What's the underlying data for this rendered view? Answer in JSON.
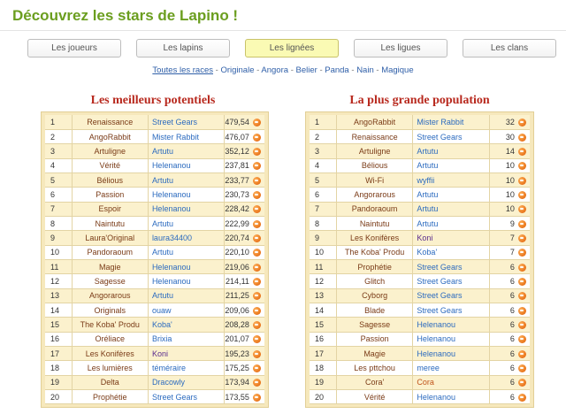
{
  "page": {
    "title": "Découvrez les stars de Lapino !"
  },
  "tabs": [
    {
      "label": "Les joueurs",
      "active": false
    },
    {
      "label": "Les lapins",
      "active": false
    },
    {
      "label": "Les lignées",
      "active": true
    },
    {
      "label": "Les ligues",
      "active": false
    },
    {
      "label": "Les clans",
      "active": false
    }
  ],
  "races": [
    "Toutes les races",
    "Originale",
    "Angora",
    "Belier",
    "Panda",
    "Nain",
    "Magique"
  ],
  "left": {
    "title": "Les meilleurs potentiels",
    "rows": [
      {
        "rank": "1",
        "name": "Renaissance",
        "player": "Street Gears",
        "value": "479,54",
        "player_color": "blue"
      },
      {
        "rank": "2",
        "name": "AngoRabbit",
        "player": "Mister Rabbit",
        "value": "476,07",
        "player_color": "blue"
      },
      {
        "rank": "3",
        "name": "Artuligne",
        "player": "Artutu",
        "value": "352,12",
        "player_color": "blue"
      },
      {
        "rank": "4",
        "name": "Vérité",
        "player": "Helenanou",
        "value": "237,81",
        "player_color": "blue"
      },
      {
        "rank": "5",
        "name": "Bélious",
        "player": "Artutu",
        "value": "233,77",
        "player_color": "blue"
      },
      {
        "rank": "6",
        "name": "Passion",
        "player": "Helenanou",
        "value": "230,73",
        "player_color": "blue"
      },
      {
        "rank": "7",
        "name": "Espoir",
        "player": "Helenanou",
        "value": "228,42",
        "player_color": "blue"
      },
      {
        "rank": "8",
        "name": "Naintutu",
        "player": "Artutu",
        "value": "222,99",
        "player_color": "blue"
      },
      {
        "rank": "9",
        "name": "Laura'Original",
        "player": "laura34400",
        "value": "220,74",
        "player_color": "blue"
      },
      {
        "rank": "10",
        "name": "Pandoraoum",
        "player": "Artutu",
        "value": "220,10",
        "player_color": "blue"
      },
      {
        "rank": "11",
        "name": "Magie",
        "player": "Helenanou",
        "value": "219,06",
        "player_color": "blue"
      },
      {
        "rank": "12",
        "name": "Sagesse",
        "player": "Helenanou",
        "value": "214,11",
        "player_color": "blue"
      },
      {
        "rank": "13",
        "name": "Angorarous",
        "player": "Artutu",
        "value": "211,25",
        "player_color": "blue"
      },
      {
        "rank": "14",
        "name": "Originals",
        "player": "ouaw",
        "value": "209,06",
        "player_color": "blue"
      },
      {
        "rank": "15",
        "name": "The Koba' Produ",
        "player": "Koba'",
        "value": "208,28",
        "player_color": "blue"
      },
      {
        "rank": "16",
        "name": "Oréliace",
        "player": "Brixia",
        "value": "201,07",
        "player_color": "blue"
      },
      {
        "rank": "17",
        "name": "Les Konifères",
        "player": "Koni",
        "value": "195,23",
        "player_color": "purple"
      },
      {
        "rank": "18",
        "name": "Les lumières",
        "player": "téméraire",
        "value": "175,25",
        "player_color": "blue"
      },
      {
        "rank": "19",
        "name": "Delta",
        "player": "Dracowly",
        "value": "173,94",
        "player_color": "blue"
      },
      {
        "rank": "20",
        "name": "Prophétie",
        "player": "Street Gears",
        "value": "173,55",
        "player_color": "blue"
      }
    ]
  },
  "right": {
    "title": "La plus grande population",
    "rows": [
      {
        "rank": "1",
        "name": "AngoRabbit",
        "player": "Mister Rabbit",
        "value": "32",
        "player_color": "blue"
      },
      {
        "rank": "2",
        "name": "Renaissance",
        "player": "Street Gears",
        "value": "30",
        "player_color": "blue"
      },
      {
        "rank": "3",
        "name": "Artuligne",
        "player": "Artutu",
        "value": "14",
        "player_color": "blue"
      },
      {
        "rank": "4",
        "name": "Bélious",
        "player": "Artutu",
        "value": "10",
        "player_color": "blue"
      },
      {
        "rank": "5",
        "name": "Wi-Fi",
        "player": "wyffii",
        "value": "10",
        "player_color": "blue"
      },
      {
        "rank": "6",
        "name": "Angorarous",
        "player": "Artutu",
        "value": "10",
        "player_color": "blue"
      },
      {
        "rank": "7",
        "name": "Pandoraoum",
        "player": "Artutu",
        "value": "10",
        "player_color": "blue"
      },
      {
        "rank": "8",
        "name": "Naintutu",
        "player": "Artutu",
        "value": "9",
        "player_color": "blue"
      },
      {
        "rank": "9",
        "name": "Les Konifères",
        "player": "Koni",
        "value": "7",
        "player_color": "purple"
      },
      {
        "rank": "10",
        "name": "The Koba' Produ",
        "player": "Koba'",
        "value": "7",
        "player_color": "blue"
      },
      {
        "rank": "11",
        "name": "Prophétie",
        "player": "Street Gears",
        "value": "6",
        "player_color": "blue"
      },
      {
        "rank": "12",
        "name": "Glitch",
        "player": "Street Gears",
        "value": "6",
        "player_color": "blue"
      },
      {
        "rank": "13",
        "name": "Cyborg",
        "player": "Street Gears",
        "value": "6",
        "player_color": "blue"
      },
      {
        "rank": "14",
        "name": "Blade",
        "player": "Street Gears",
        "value": "6",
        "player_color": "blue"
      },
      {
        "rank": "15",
        "name": "Sagesse",
        "player": "Helenanou",
        "value": "6",
        "player_color": "blue"
      },
      {
        "rank": "16",
        "name": "Passion",
        "player": "Helenanou",
        "value": "6",
        "player_color": "blue"
      },
      {
        "rank": "17",
        "name": "Magie",
        "player": "Helenanou",
        "value": "6",
        "player_color": "blue"
      },
      {
        "rank": "18",
        "name": "Les pttchou",
        "player": "meree",
        "value": "6",
        "player_color": "blue"
      },
      {
        "rank": "19",
        "name": "Cora'",
        "player": "Cora",
        "value": "6",
        "player_color": "orange"
      },
      {
        "rank": "20",
        "name": "Vérité",
        "player": "Helenanou",
        "value": "6",
        "player_color": "blue"
      }
    ]
  },
  "icons": {
    "row_badge": "medal-icon"
  },
  "colors": {
    "title": "#6b9e1f",
    "section_title": "#b8291e",
    "active_tab": "#fafab4",
    "link": "#2f5fa8"
  }
}
